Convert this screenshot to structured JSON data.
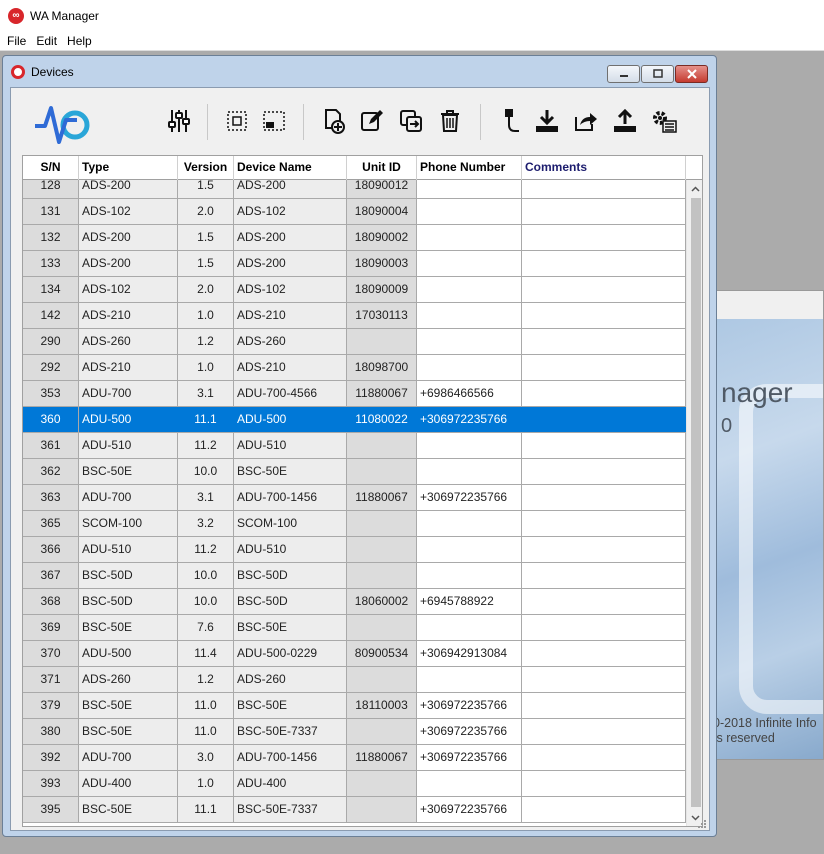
{
  "app": {
    "title": "WA Manager",
    "menu": [
      "File",
      "Edit",
      "Help"
    ]
  },
  "splash": {
    "title_fragment": "nager",
    "version_fragment": "0",
    "copyright_line1": "0-2018 Infinite Info",
    "copyright_line2": "ts reserved"
  },
  "devices_window": {
    "title": "Devices",
    "toolbar": [
      {
        "icon": "settings-sliders-icon",
        "label": "Settings"
      },
      {
        "icon": "select-all-icon",
        "label": "Select all"
      },
      {
        "icon": "select-partial-icon",
        "label": "Select partial"
      },
      {
        "icon": "add-device-icon",
        "label": "Add device"
      },
      {
        "icon": "edit-icon",
        "label": "Edit"
      },
      {
        "icon": "copy-icon",
        "label": "Copy"
      },
      {
        "icon": "delete-icon",
        "label": "Delete"
      },
      {
        "icon": "usb-icon",
        "label": "USB"
      },
      {
        "icon": "download-icon",
        "label": "Download"
      },
      {
        "icon": "share-icon",
        "label": "Share"
      },
      {
        "icon": "upload-icon",
        "label": "Upload"
      },
      {
        "icon": "advanced-settings-icon",
        "label": "Advanced settings"
      }
    ],
    "columns": [
      "S/N",
      "Type",
      "Version",
      "Device Name",
      "Unit ID",
      "Phone Number",
      "Comments"
    ],
    "rows": [
      [
        "128",
        "ADS-200",
        "1.5",
        "ADS-200",
        "18090012",
        "",
        ""
      ],
      [
        "131",
        "ADS-102",
        "2.0",
        "ADS-102",
        "18090004",
        "",
        ""
      ],
      [
        "132",
        "ADS-200",
        "1.5",
        "ADS-200",
        "18090002",
        "",
        ""
      ],
      [
        "133",
        "ADS-200",
        "1.5",
        "ADS-200",
        "18090003",
        "",
        ""
      ],
      [
        "134",
        "ADS-102",
        "2.0",
        "ADS-102",
        "18090009",
        "",
        ""
      ],
      [
        "142",
        "ADS-210",
        "1.0",
        "ADS-210",
        "17030113",
        "",
        ""
      ],
      [
        "290",
        "ADS-260",
        "1.2",
        "ADS-260",
        "",
        "",
        ""
      ],
      [
        "292",
        "ADS-210",
        "1.0",
        "ADS-210",
        "18098700",
        "",
        ""
      ],
      [
        "353",
        "ADU-700",
        "3.1",
        "ADU-700-4566",
        "11880067",
        "+6986466566",
        ""
      ],
      [
        "360",
        "ADU-500",
        "11.1",
        "ADU-500",
        "11080022",
        "+306972235766",
        ""
      ],
      [
        "361",
        "ADU-510",
        "11.2",
        "ADU-510",
        "",
        "",
        ""
      ],
      [
        "362",
        "BSC-50E",
        "10.0",
        "BSC-50E",
        "",
        "",
        ""
      ],
      [
        "363",
        "ADU-700",
        "3.1",
        "ADU-700-1456",
        "11880067",
        "+306972235766",
        ""
      ],
      [
        "365",
        "SCOM-100",
        "3.2",
        "SCOM-100",
        "",
        "",
        ""
      ],
      [
        "366",
        "ADU-510",
        "11.2",
        "ADU-510",
        "",
        "",
        ""
      ],
      [
        "367",
        "BSC-50D",
        "10.0",
        "BSC-50D",
        "",
        "",
        ""
      ],
      [
        "368",
        "BSC-50D",
        "10.0",
        "BSC-50D",
        "18060002",
        "+6945788922",
        ""
      ],
      [
        "369",
        "BSC-50E",
        "7.6",
        "BSC-50E",
        "",
        "",
        ""
      ],
      [
        "370",
        "ADU-500",
        "11.4",
        "ADU-500-0229",
        "80900534",
        "+306942913084",
        ""
      ],
      [
        "371",
        "ADS-260",
        "1.2",
        "ADS-260",
        "",
        "",
        ""
      ],
      [
        "379",
        "BSC-50E",
        "11.0",
        "BSC-50E",
        "18110003",
        "+306972235766",
        ""
      ],
      [
        "380",
        "BSC-50E",
        "11.0",
        "BSC-50E-7337",
        "",
        "+306972235766",
        ""
      ],
      [
        "392",
        "ADU-700",
        "3.0",
        "ADU-700-1456",
        "11880067",
        "+306972235766",
        ""
      ],
      [
        "393",
        "ADU-400",
        "1.0",
        "ADU-400",
        "",
        "",
        ""
      ],
      [
        "395",
        "BSC-50E",
        "11.1",
        "BSC-50E-7337",
        "",
        "+306972235766",
        ""
      ]
    ],
    "selected_row_index": 9
  },
  "colors": {
    "selection": "#0078d7",
    "close_button": "#c53b30",
    "logo_blue": "#2f6bd6",
    "logo_cyan": "#2aa6d8"
  }
}
